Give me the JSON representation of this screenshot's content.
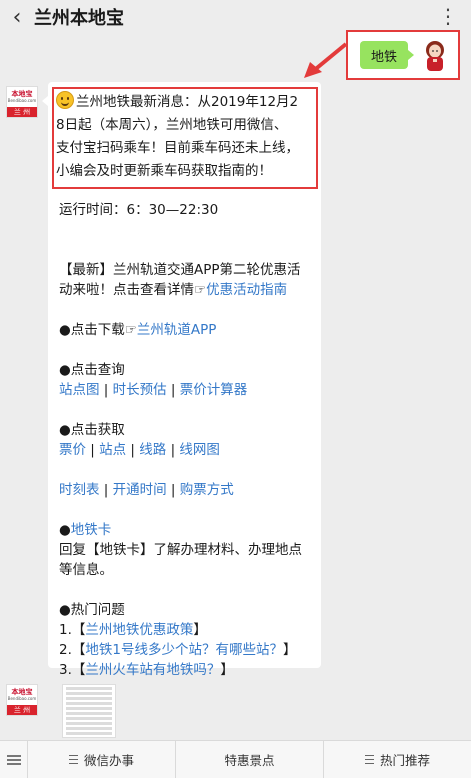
{
  "header": {
    "back_icon": "‹",
    "title": "兰州本地宝",
    "more_icon": "⋮"
  },
  "user_message": {
    "text": "地铁",
    "bubble_color": "#97e35f"
  },
  "bot_avatar": {
    "line1": "本地宝",
    "line2": "Bendibao.com",
    "line3": "兰 州",
    "brand_color": "#d9232d"
  },
  "highlight_border_color": "#e33b3b",
  "message": {
    "highlight_lines": [
      "兰州地铁最新消息：从2019年12月2",
      "8日起（本周六），兰州地铁可用微信、",
      "支付宝扫码乘车！目前乘车码还未上线，",
      "小编会及时更新乘车码获取指南的！"
    ],
    "hours": "运行时间：6：30—22:30",
    "promo_line1": "【最新】兰州轨道交通APP第二轮优惠活",
    "promo_line2_prefix": "动来啦！点击查看详情",
    "promo_pointer": "☞",
    "promo_link": "优惠活动指南",
    "download_prefix": "●点击下载",
    "download_pointer": "☞",
    "download_link": "兰州轨道APP",
    "query_label": "●点击查询",
    "query_links": [
      "站点图",
      "时长预估",
      "票价计算器"
    ],
    "get_label": "●点击获取",
    "get_links_1": [
      "票价",
      "站点",
      "线路",
      "线网图"
    ],
    "get_links_2": [
      "时刻表",
      "开通时间",
      "购票方式"
    ],
    "sep": " | ",
    "card_bullet": "●",
    "card_link": "地铁卡",
    "card_desc1": "回复【地铁卡】了解办理材料、办理地点",
    "card_desc2": "等信息。",
    "hot_label": "●热门问题",
    "hot_items": [
      {
        "num": "1.",
        "open": "【",
        "link": "兰州地铁优惠政策",
        "close": "】"
      },
      {
        "num": "2.",
        "open": "【",
        "link": "地铁1号线多少个站？有哪些站？",
        "close": "】"
      },
      {
        "num": "3.",
        "open": "【",
        "link": "兰州火车站有地铁吗？",
        "close": "】"
      }
    ]
  },
  "bottom_menu": [
    "微信办事",
    "特惠景点",
    "热门推荐"
  ],
  "link_color": "#3478c8"
}
